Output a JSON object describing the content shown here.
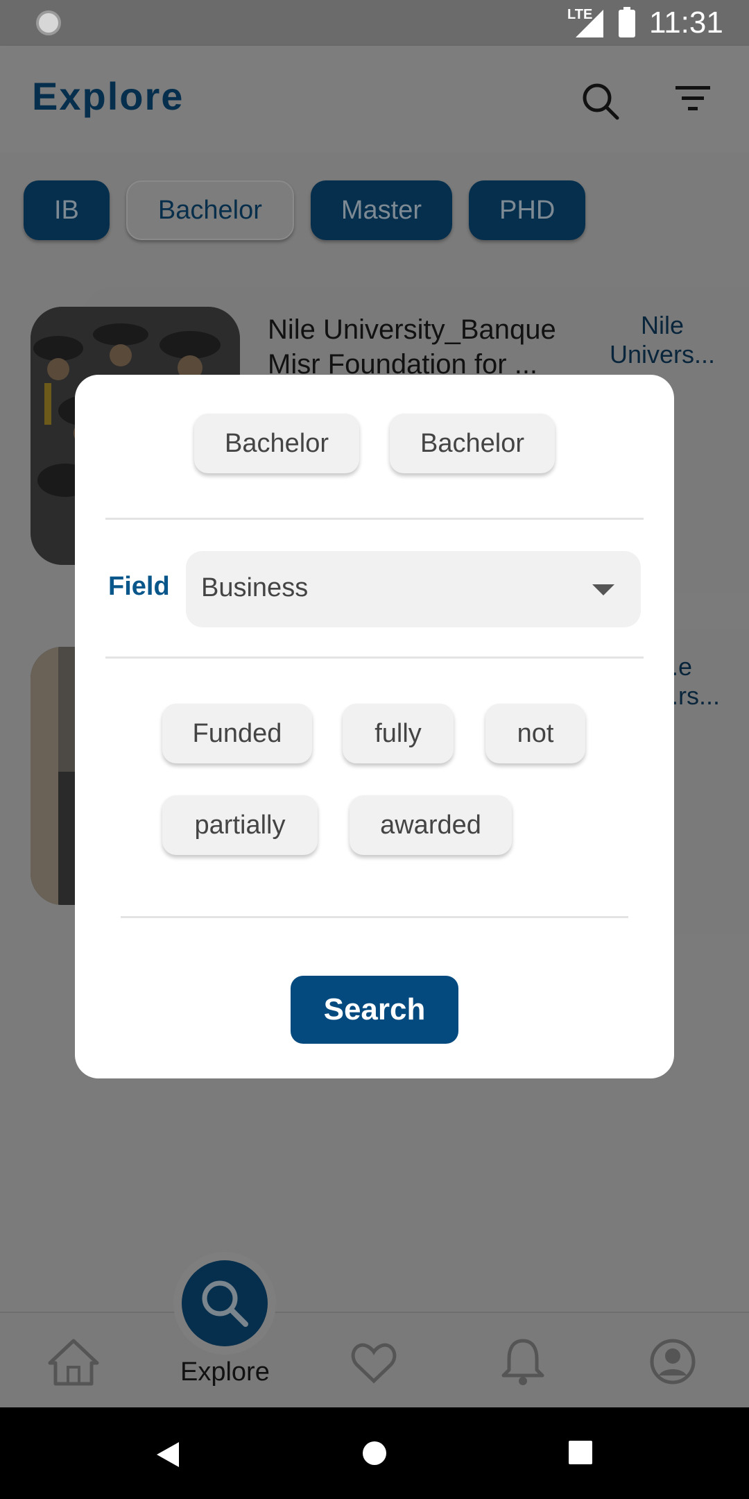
{
  "status_bar": {
    "network": "LTE",
    "time": "11:31"
  },
  "app_bar": {
    "title": "Explore",
    "icons": [
      "search-icon",
      "filter-icon"
    ]
  },
  "level_chips": [
    {
      "label": "IB",
      "selected": true
    },
    {
      "label": "Bachelor",
      "selected": false
    },
    {
      "label": "Master",
      "selected": true
    },
    {
      "label": "PHD",
      "selected": true
    }
  ],
  "cards": [
    {
      "title": "Nile University_Banque Misr Foundation for ...",
      "university": "Nile Univers..."
    },
    {
      "title": "",
      "university": "...e ...rs..."
    }
  ],
  "dialog": {
    "level_options": [
      "Bachelor",
      "Bachelor"
    ],
    "field_label": "Field",
    "field_value": "Business",
    "funding_options": [
      "Funded",
      "fully",
      "not",
      "partially",
      "awarded"
    ],
    "search_label": "Search"
  },
  "bottom_nav": {
    "items": [
      "home-icon",
      "search-icon",
      "heart-icon",
      "bell-icon",
      "account-icon"
    ],
    "active_label": "Explore"
  },
  "colors": {
    "primary": "#062f4d",
    "accent_blue": "#044a7e",
    "scrim": "#7b7b7b"
  }
}
